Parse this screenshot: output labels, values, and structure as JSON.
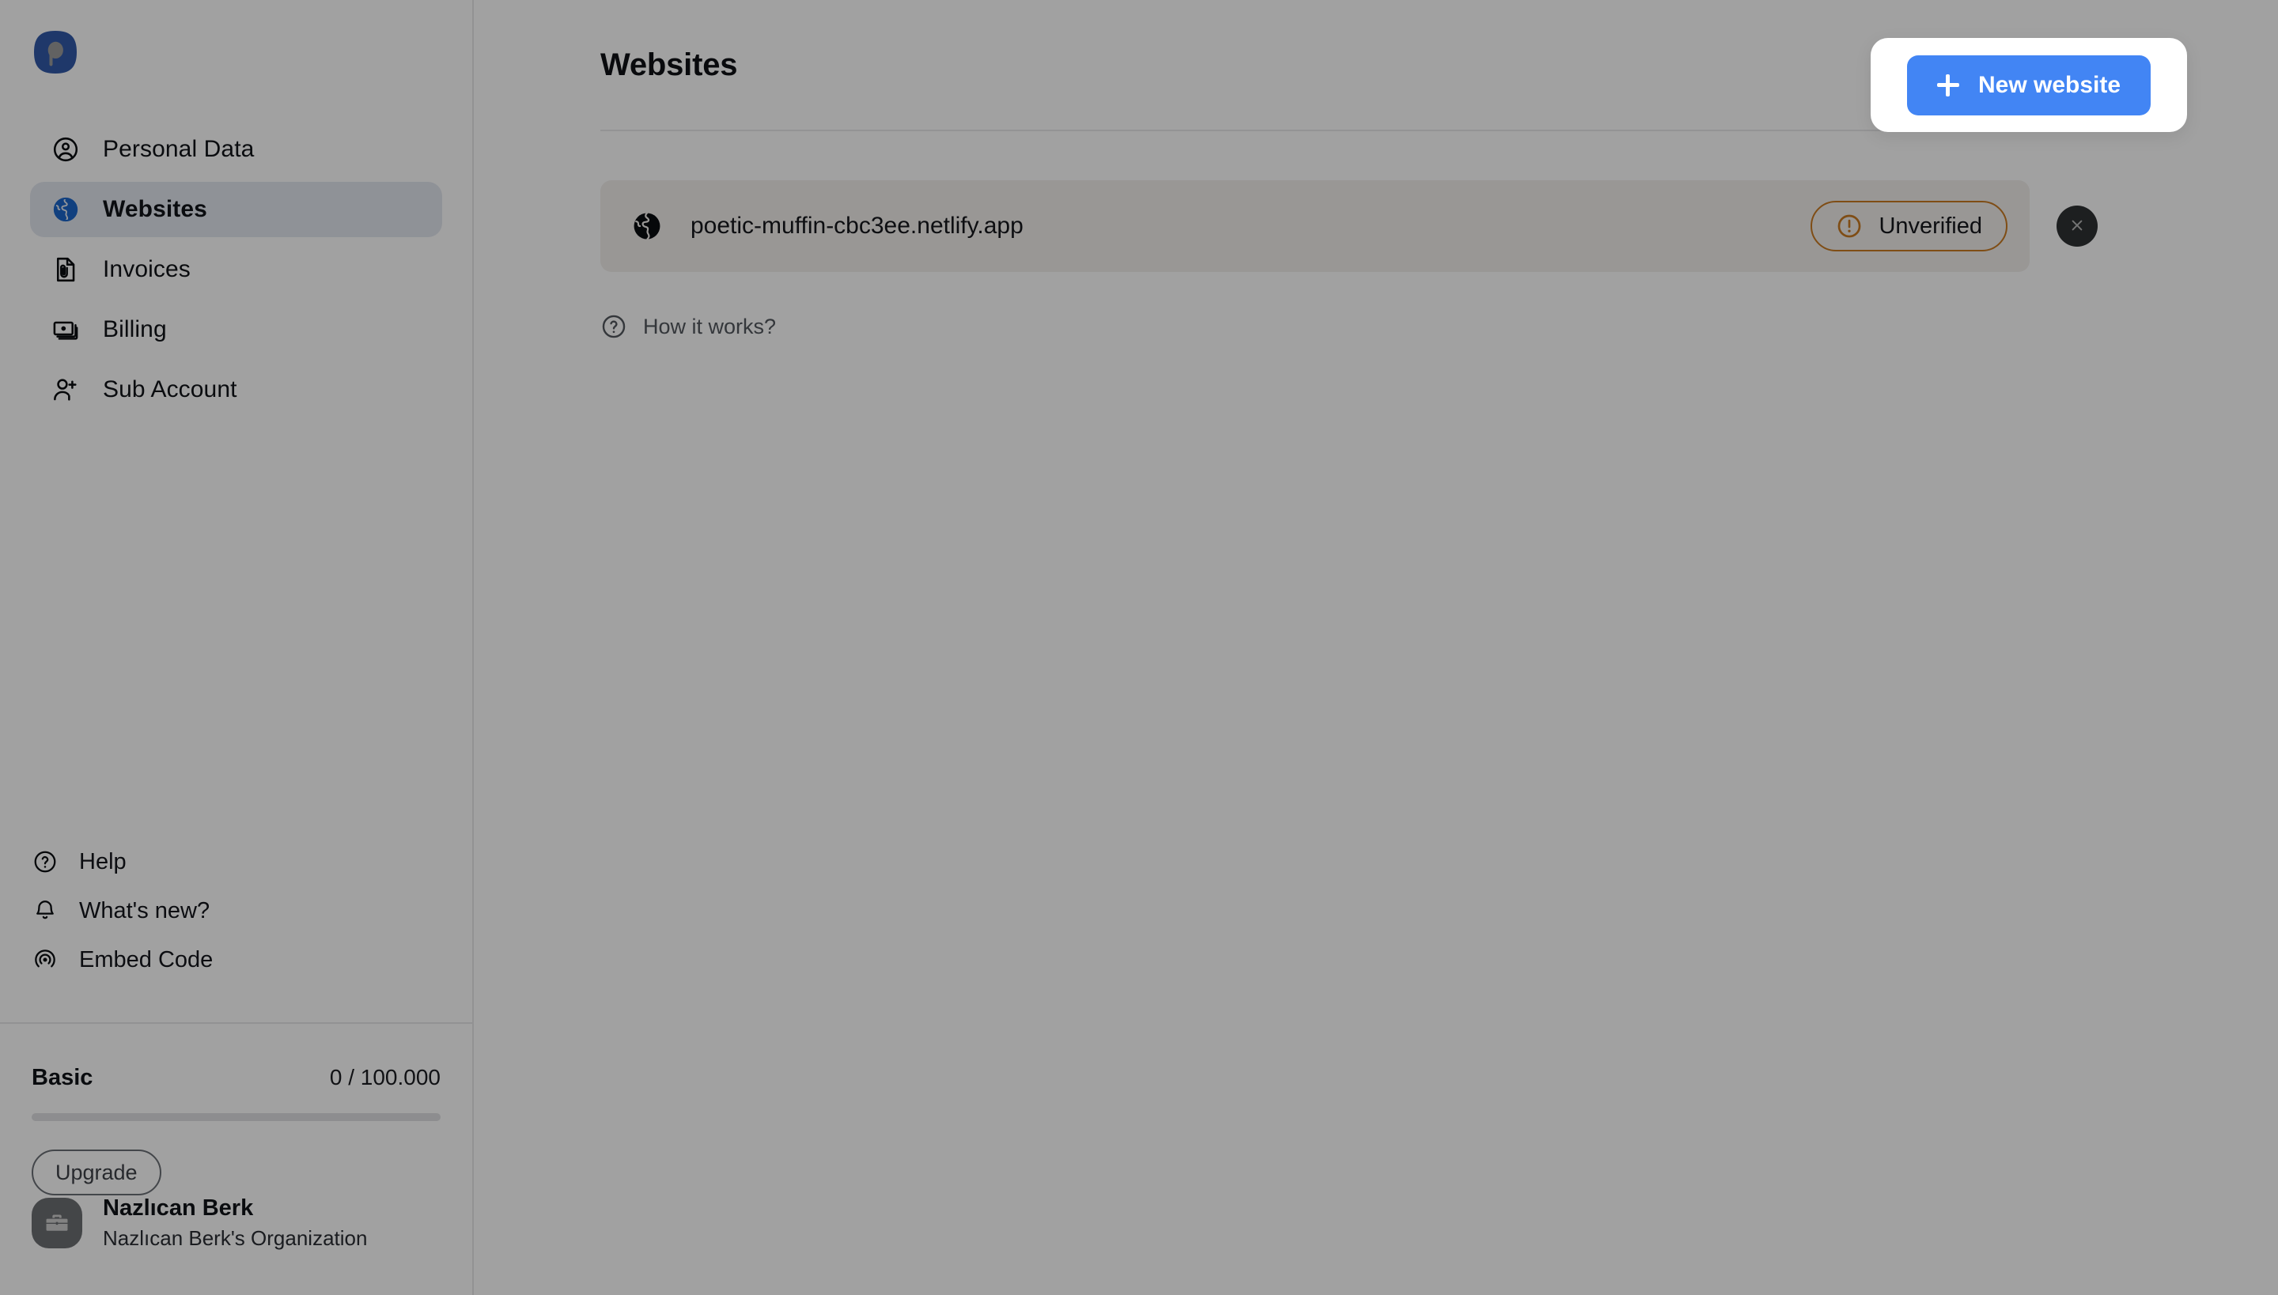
{
  "brand": {
    "logo_name": "peasy-logo",
    "logo_color": "#3259a8"
  },
  "sidebar": {
    "primary_items": [
      {
        "id": "personal-data",
        "label": "Personal Data",
        "icon": "user-circle-icon",
        "active": false
      },
      {
        "id": "websites",
        "label": "Websites",
        "icon": "globe-icon",
        "active": true
      },
      {
        "id": "invoices",
        "label": "Invoices",
        "icon": "invoice-icon",
        "active": false
      },
      {
        "id": "billing",
        "label": "Billing",
        "icon": "billing-card-icon",
        "active": false
      },
      {
        "id": "sub-account",
        "label": "Sub Account",
        "icon": "user-plus-icon",
        "active": false
      }
    ],
    "secondary_items": [
      {
        "id": "help",
        "label": "Help",
        "icon": "help-circle-icon"
      },
      {
        "id": "whats-new",
        "label": "What's new?",
        "icon": "bell-icon"
      },
      {
        "id": "embed-code",
        "label": "Embed Code",
        "icon": "broadcast-icon"
      }
    ],
    "plan": {
      "name": "Basic",
      "quota": "0 / 100.000",
      "progress_percent": 0,
      "upgrade_label": "Upgrade"
    },
    "user": {
      "name": "Nazlıcan Berk",
      "organization": "Nazlıcan Berk's Organization",
      "avatar_icon": "briefcase-icon"
    }
  },
  "main": {
    "title": "Websites",
    "new_website_label": "New website",
    "new_website_color": "#4285f4",
    "websites": [
      {
        "url": "poetic-muffin-cbc3ee.netlify.app",
        "icon": "globe-icon",
        "status": "Unverified",
        "status_color": "#c97b22"
      }
    ],
    "how_it_works_label": "How it works?"
  }
}
